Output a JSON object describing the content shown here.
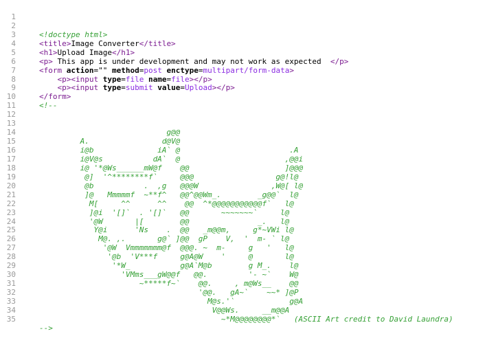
{
  "line_numbers": [
    "1",
    "2",
    "3",
    "4",
    "5",
    "6",
    "7",
    "8",
    "9",
    "10",
    "11",
    "12",
    "13",
    "14",
    "15",
    "16",
    "17",
    "18",
    "19",
    "20",
    "21",
    "22",
    "23",
    "24",
    "25",
    "26",
    "27",
    "28",
    "29",
    "30",
    "31",
    "32",
    "33",
    "34",
    "35"
  ],
  "code": {
    "doctype": "<!doctype html>",
    "title_open": "<title>",
    "title_text": "Image Converter",
    "title_close": "</title>",
    "h1_open": "<h1>",
    "h1_text": "Upload Image",
    "h1_close": "</h1>",
    "p_open": "<p>",
    "p_text": " This app is under development and may not work as expected  ",
    "p_close": "</p>",
    "form_open": "<form",
    "form_action_attr": "action",
    "form_action_val": "\"\"",
    "form_method_attr": "method",
    "form_method_val": "post",
    "form_enctype_attr": "enctype",
    "form_enctype_val": "multipart/form-data",
    "form_gt": ">",
    "p2_open": "<p><input",
    "input1_type_attr": "type",
    "input1_type_val": "file",
    "input1_name_attr": "name",
    "input1_name_val": "file",
    "input1_close": "></p>",
    "p3_open": "<p><input",
    "input2_type_attr": "type",
    "input2_type_val": "submit",
    "input2_value_attr": "value",
    "input2_value_val": "Upload",
    "input2_close": "></p>",
    "form_close": "</form>",
    "comment_open": "<!--",
    "comment_close": "-->",
    "ascii_art": [
      "",
      "",
      "                            g@@",
      "         A.                d@V@",
      "         i@b              iA` @                        .A",
      "         i@V@s           dA`  @                       ,@@i",
      "         i@ '*@Ws______mW@f    @@                     ]@@@",
      "          @]  '^********f`     @@@                  g@!l@",
      "          @b           .  ,g   @@@W                ,W@[ l@",
      "          ]@   Mmmmmf  ~**f^   @@^@@Wm_.        _g@@`  l@",
      "           M[     ^^      ^^    @@  ^*@@@@@@@@@@@f`   l@",
      "           ]@i  '[]`  . '[]`   @@       ~~~~~~~`     l@",
      "           '@W       |[        @@               _.   l@",
      "            Y@i      'Ns    .  @@   _m@@m,     g*~VWi l@",
      "             M@. ,.       g@` ]@@  gP    V,  '  m- ` l@",
      "              '@W  Vmmmmmmm@f  @@@. ~  m-     g   '   l@",
      "               '@b  'V***f     g@A@W    '     @       l@",
      "                '*W_           g@A`M@b        g M_.    l@",
      "                  'VMms___gW@@f   @@.         '- ~`    W@",
      "                      ~*****f~`    @@.     , m@Ws__    @@",
      "                                   '@@.   gA~`    ~~* ]@P",
      "                                     M@s.'`            g@A",
      "                                      V@@Ws.     __m@@A",
      "                                        ~*M@@@@@@@@*`   (ASCII Art credit to David Laundra)"
    ]
  }
}
